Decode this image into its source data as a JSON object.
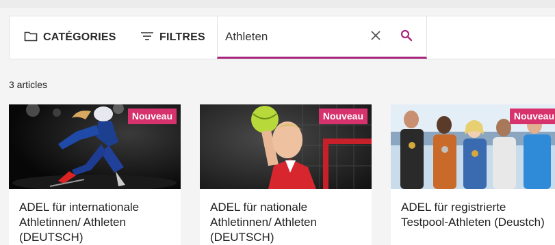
{
  "toolbar": {
    "categories_label": "CATÉGORIES",
    "filters_label": "FILTRES",
    "search_value": "Athleten",
    "accent_color": "#a6247d"
  },
  "results": {
    "count_label": "3 articles"
  },
  "cards": [
    {
      "badge": "Nouveau",
      "title": "ADEL für internationale Athletinnen/ Athleten (DEUTSCH)"
    },
    {
      "badge": "Nouveau",
      "title": "ADEL für nationale Athletinnen/ Athleten (DEUTSCH)"
    },
    {
      "badge": "Nouveau",
      "title": "ADEL für registrierte Testpool-Athleten (Deustch)"
    }
  ],
  "colors": {
    "badge": "#d6336c",
    "background": "#f4f4f4"
  },
  "icons": {
    "categories": "folder-icon",
    "filters": "filter-lines-icon",
    "clear": "close-icon",
    "search": "search-icon"
  }
}
